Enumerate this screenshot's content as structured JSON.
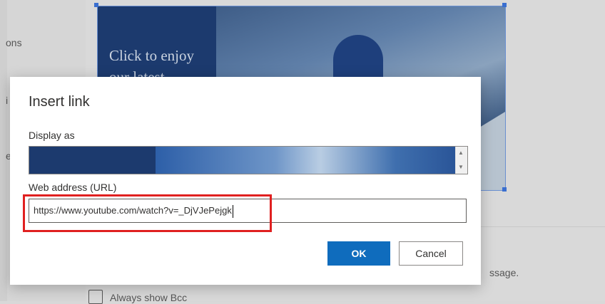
{
  "background": {
    "side_text_1": "ons",
    "side_text_2": "i",
    "side_text_3": "e",
    "promo_text": "Click to enjoy our latest",
    "message_fragment": "ssage.",
    "checkbox_label": "Always show Bcc"
  },
  "dialog": {
    "title": "Insert link",
    "display_label": "Display as",
    "url_label": "Web address (URL)",
    "url_value": "https://www.youtube.com/watch?v=_DjVJePejgk",
    "ok_label": "OK",
    "cancel_label": "Cancel"
  },
  "colors": {
    "primary_button": "#0f6cbd",
    "highlight_border": "#e02020"
  }
}
